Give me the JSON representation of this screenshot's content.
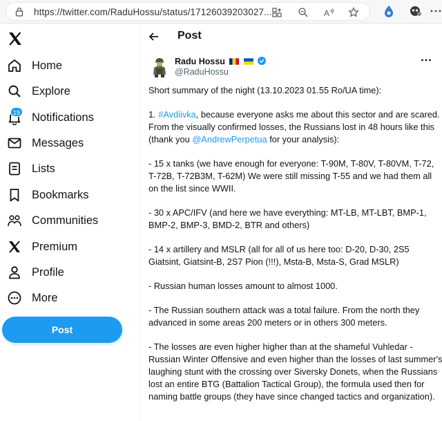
{
  "browser": {
    "url": "https://twitter.com/RaduHossu/status/17126039203027..."
  },
  "sidebar": {
    "items": [
      {
        "label": "Home",
        "icon": "home-icon"
      },
      {
        "label": "Explore",
        "icon": "search-icon"
      },
      {
        "label": "Notifications",
        "icon": "bell-icon",
        "badge": "19"
      },
      {
        "label": "Messages",
        "icon": "envelope-icon"
      },
      {
        "label": "Lists",
        "icon": "list-icon"
      },
      {
        "label": "Bookmarks",
        "icon": "bookmark-icon"
      },
      {
        "label": "Communities",
        "icon": "people-icon"
      },
      {
        "label": "Premium",
        "icon": "x-logo-icon"
      },
      {
        "label": "Profile",
        "icon": "person-icon"
      },
      {
        "label": "More",
        "icon": "more-circle-icon"
      }
    ],
    "post_label": "Post"
  },
  "header": {
    "title": "Post"
  },
  "tweet": {
    "author_name": "Radu Hossu",
    "handle": "@RaduHossu",
    "p1": "Short summary of the night (13.10.2023 01.55 Ro/UA time):",
    "p2_num": "1. ",
    "p2_hashtag": "#Avdiivka",
    "p2_mid": ", because everyone asks me about this sector and are scared. From the visually confirmed losses, the Russians lost in 48 hours like this (thank you ",
    "p2_mention": "@AndrewPerpetua",
    "p2_end": " for your analysis):",
    "p3": "- 15 x tanks (we have enough for everyone: T-90M, T-80V, T-80VM, T-72, T-72B, T-72B3M, T-62M) We were still missing T-55 and we had them all on the list since WWII.",
    "p4": "- 30 x APC/IFV (and here we have everything: MT-LB, MT-LBT, BMP-1, BMP-2, BMP-3, BMD-2, BTR and others)",
    "p5": "- 14 x artillery and MSLR (all for all of us here too: D-20, D-30, 2S5 Giatsint, Giatsint-B, 2S7 Pion (!!!), Msta-B, Msta-S, Grad MSLR)",
    "p6": "- Russian human losses amount to almost 1000.",
    "p7": "- The Russian southern attack was a total failure. From the north they advanced in some areas 200 meters or in others 300 meters.",
    "p8": "- The losses are even higher higher than at the shameful Vuhledar - Russian Winter Offensive and even higher than the losses of last summer's laughing stunt with the crossing over Siversky Donets, when the Russians lost an entire BTG (Battalion Tactical Group), the formula used then for naming battle groups (they have since changed tactics and organization)."
  },
  "colors": {
    "accent": "#1d9bf0",
    "text": "#0f1419",
    "muted": "#536471"
  }
}
